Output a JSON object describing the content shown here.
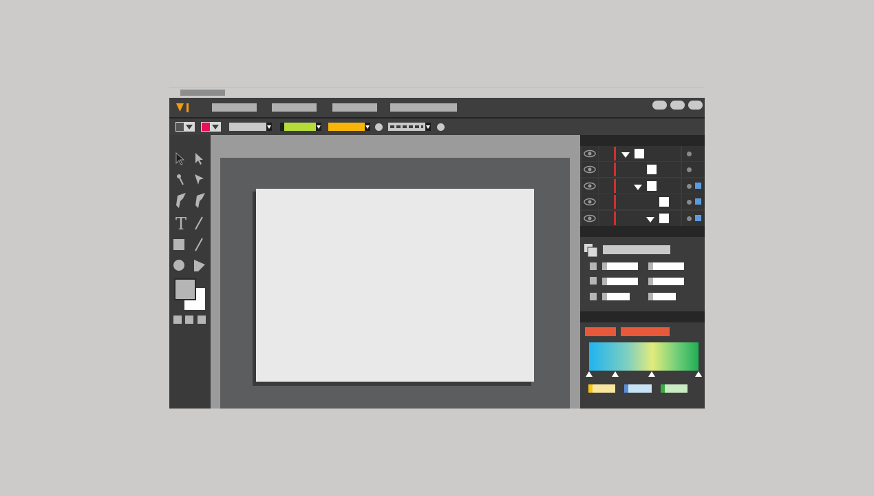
{
  "app": {
    "logo_text": "VI",
    "accent": "#f39c12"
  },
  "menubar": {
    "items": [
      "",
      "",
      "",
      ""
    ]
  },
  "toolbar": {
    "stroke_swatch_color": "#555555",
    "fill_swatch_color": "#e8105a",
    "color_fields": [
      "#c9c9c9",
      "#b5dd3a",
      "#f7b50a"
    ]
  },
  "layers": {
    "rows": [
      {
        "indent": 0,
        "expanded": true,
        "target_color": null
      },
      {
        "indent": 1,
        "expanded": false,
        "target_color": null
      },
      {
        "indent": 1,
        "expanded": true,
        "target_color": "#5a9be0"
      },
      {
        "indent": 2,
        "expanded": false,
        "target_color": "#5a9be0"
      },
      {
        "indent": 2,
        "expanded": true,
        "target_color": "#5a9be0"
      }
    ],
    "visibility_icon": "eye-icon"
  },
  "gradient_panel": {
    "stops_colors": [
      "#1fb4f0",
      "#e2eb7c",
      "#1fae55"
    ],
    "swatches": [
      "#f7e6a0",
      "#c8e4f4",
      "#c9ecc3"
    ],
    "swatch_tabs": [
      "#f5c518",
      "#5a8fd6",
      "#3aaa45"
    ],
    "header_buttons_color": "#e8583a"
  }
}
